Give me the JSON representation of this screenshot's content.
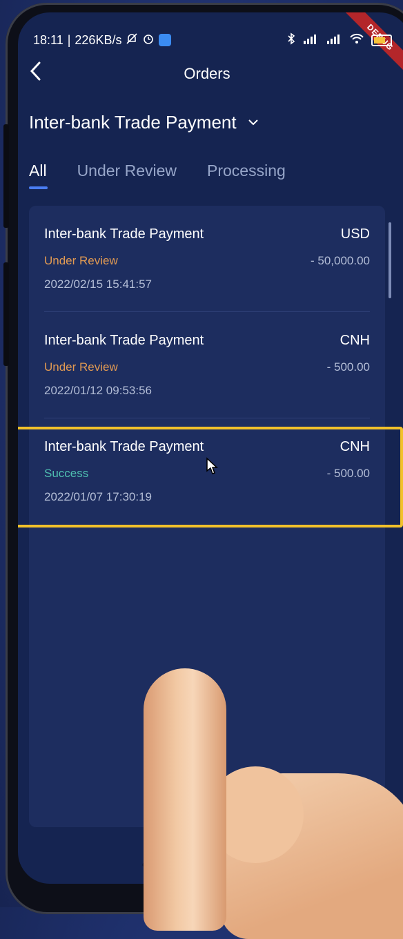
{
  "status_bar": {
    "time": "18:11",
    "speed": "226KB/s",
    "icons_left": [
      "mute-bell-icon",
      "alarm-icon",
      "app-badge-icon"
    ],
    "icons_right": [
      "bluetooth-icon",
      "signal-hd-icon",
      "signal-hd-icon",
      "wifi-icon",
      "battery-icon"
    ],
    "battery_color": "#f5c33b"
  },
  "debug_ribbon": "DEBUG",
  "header": {
    "title": "Orders",
    "back_icon": "back-arrow-icon"
  },
  "category": {
    "selected": "Inter-bank Trade Payment",
    "icon": "chevron-down-icon"
  },
  "tabs": [
    {
      "label": "All",
      "active": true
    },
    {
      "label": "Under Review",
      "active": false
    },
    {
      "label": "Processing",
      "active": false
    }
  ],
  "orders": [
    {
      "title": "Inter-bank Trade Payment",
      "currency": "USD",
      "status": "Under Review",
      "amount": "- 50,000.00",
      "time": "2022/02/15 15:41:57"
    },
    {
      "title": "Inter-bank Trade Payment",
      "currency": "CNH",
      "status": "Under Review",
      "amount": "- 500.00",
      "time": "2022/01/12 09:53:56"
    },
    {
      "title": "Inter-bank Trade Payment",
      "currency": "CNH",
      "status": "Success",
      "amount": "- 500.00",
      "time": "2022/01/07 17:30:19"
    }
  ],
  "colors": {
    "accent": "#4a7df2",
    "status_review": "#e29a52",
    "status_success": "#4fbfb0",
    "highlight": "#f2c12a"
  }
}
